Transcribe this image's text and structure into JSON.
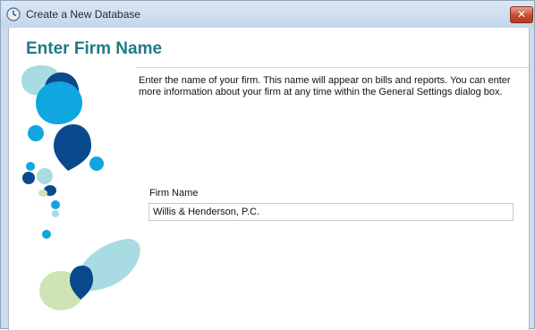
{
  "window": {
    "title": "Create a New Database",
    "close_glyph": "✕",
    "app_icon": "clock-icon"
  },
  "page": {
    "heading": "Enter Firm Name",
    "description": "Enter the name of your firm. This name will appear on bills and reports. You can enter more information about your firm at any time within the General Settings dialog box."
  },
  "form": {
    "firm_name_label": "Firm Name",
    "firm_name_value": "Willis & Henderson, P.C."
  },
  "colors": {
    "heading": "#1f7a86",
    "accent_dark_blue": "#0a4a8c",
    "accent_cyan": "#10a6e0",
    "accent_light_teal": "#a9dbe2",
    "accent_light_green": "#cfe4b4",
    "close_button": "#c74a31"
  }
}
